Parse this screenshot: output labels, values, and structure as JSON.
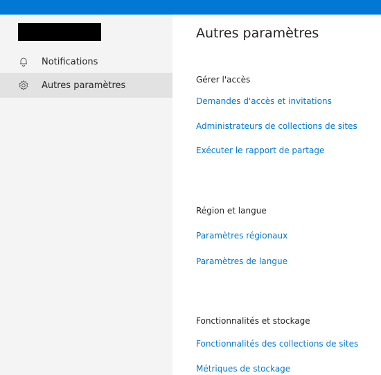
{
  "colors": {
    "accent": "#0078d4",
    "sidebar_bg": "#f4f4f4",
    "active_bg": "#e2e2e2",
    "text": "#252525"
  },
  "sidebar": {
    "items": [
      {
        "label": "Notifications",
        "icon": "bell-icon",
        "active": false
      },
      {
        "label": "Autres paramètres",
        "icon": "gear-icon",
        "active": true
      }
    ]
  },
  "main": {
    "title": "Autres paramètres",
    "sections": [
      {
        "heading": "Gérer l'accès",
        "links": [
          "Demandes d'accès et invitations",
          "Administrateurs de collections de sites",
          "Exécuter le rapport de partage"
        ]
      },
      {
        "heading": "Région et langue",
        "links": [
          "Paramètres régionaux",
          "Paramètres de langue"
        ]
      },
      {
        "heading": "Fonctionnalités et stockage",
        "links": [
          "Fonctionnalités des collections de sites",
          "Métriques de stockage"
        ]
      }
    ]
  }
}
